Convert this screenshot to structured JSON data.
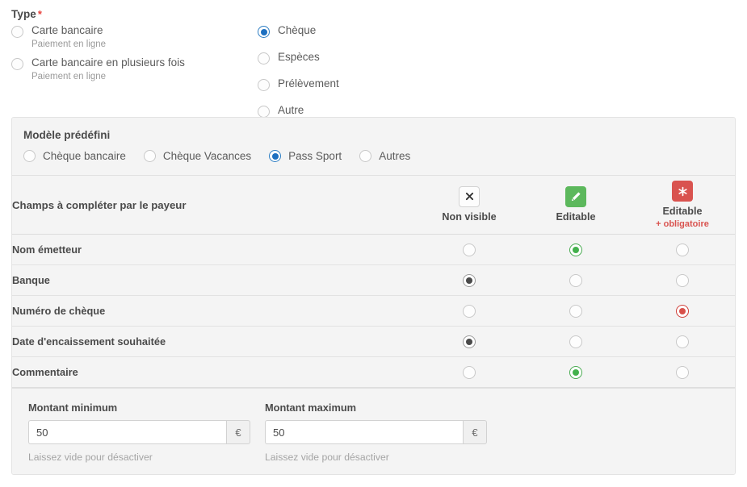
{
  "type_section": {
    "title": "Type",
    "required_marker": "*",
    "left_options": [
      {
        "label": "Carte bancaire",
        "sub": "Paiement en ligne",
        "state": "off"
      },
      {
        "label": "Carte bancaire en plusieurs fois",
        "sub": "Paiement en ligne",
        "state": "off"
      }
    ],
    "right_options": [
      {
        "label": "Chèque",
        "state": "blue"
      },
      {
        "label": "Espèces",
        "state": "off"
      },
      {
        "label": "Prélèvement",
        "state": "off"
      },
      {
        "label": "Autre",
        "state": "off"
      }
    ]
  },
  "model": {
    "title": "Modèle prédéfini",
    "options": [
      {
        "label": "Chèque bancaire",
        "state": "off"
      },
      {
        "label": "Chèque Vacances",
        "state": "off"
      },
      {
        "label": "Pass Sport",
        "state": "blue"
      },
      {
        "label": "Autres",
        "state": "off"
      }
    ]
  },
  "fields_table": {
    "header_label": "Champs à compléter par le payeur",
    "columns": [
      {
        "icon": "close-icon",
        "icon_style": "white",
        "title": "Non visible",
        "sub": ""
      },
      {
        "icon": "pencil-icon",
        "icon_style": "green",
        "title": "Editable",
        "sub": ""
      },
      {
        "icon": "asterisk-icon",
        "icon_style": "red",
        "title": "Editable",
        "sub": "+ obligatoire"
      }
    ],
    "rows": [
      {
        "name": "Nom émetteur",
        "states": [
          "off",
          "green",
          "off"
        ]
      },
      {
        "name": "Banque",
        "states": [
          "dark",
          "off",
          "off"
        ]
      },
      {
        "name": "Numéro de chèque",
        "states": [
          "off",
          "off",
          "red"
        ]
      },
      {
        "name": "Date d'encaissement souhaitée",
        "states": [
          "dark",
          "off",
          "off"
        ]
      },
      {
        "name": "Commentaire",
        "states": [
          "off",
          "green",
          "off"
        ]
      }
    ]
  },
  "amounts": [
    {
      "label": "Montant minimum",
      "value": "50",
      "placeholder": "",
      "currency": "€",
      "help": "Laissez vide pour désactiver"
    },
    {
      "label": "Montant maximum",
      "value": "50",
      "placeholder": "",
      "currency": "€",
      "help": "Laissez vide pour désactiver"
    }
  ],
  "colors": {
    "blue": "#1c6fc0",
    "green": "#5cb85c",
    "red": "#d9534f",
    "required": "#e8403a",
    "panel_bg": "#f4f4f4"
  }
}
